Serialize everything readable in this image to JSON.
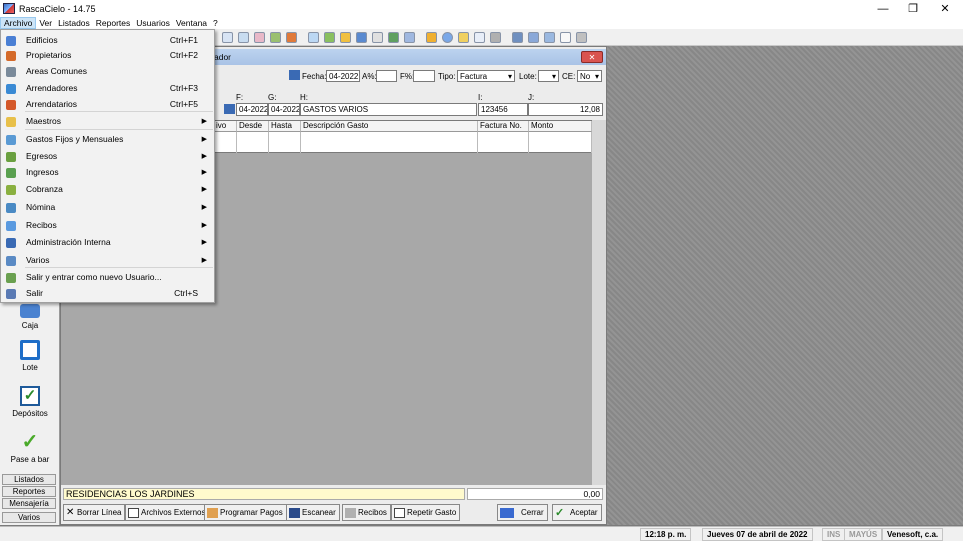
{
  "app": {
    "title": "RascaCielo - 14.75"
  },
  "menubar": [
    "Archivo",
    "Ver",
    "Listados",
    "Reportes",
    "Usuarios",
    "Ventana",
    "?"
  ],
  "archivo_menu": [
    {
      "label": "Edificios",
      "shortcut": "Ctrl+F1",
      "icon": "building-icon",
      "color": "#4a7fd4"
    },
    {
      "label": "Propietarios",
      "shortcut": "Ctrl+F2",
      "icon": "owner-icon",
      "color": "#d46a2a"
    },
    {
      "label": "Areas Comunes",
      "shortcut": "",
      "icon": "common-area-icon",
      "color": "#7a8a9a"
    },
    {
      "label": "Arrendadores",
      "shortcut": "Ctrl+F3",
      "icon": "landlord-icon",
      "color": "#3a8ad4"
    },
    {
      "label": "Arrendatarios",
      "shortcut": "Ctrl+F5",
      "icon": "tenant-icon",
      "color": "#d4582a"
    },
    {
      "label": "Maestros",
      "arrow": "▶",
      "icon": "folder-icon",
      "color": "#e8c04a"
    },
    {
      "label": "Gastos Fijos y Mensuales",
      "arrow": "▶",
      "icon": "expenses-icon",
      "color": "#5a9ad4"
    },
    {
      "label": "Egresos",
      "arrow": "▶",
      "icon": "outflow-icon",
      "color": "#6aa040"
    },
    {
      "label": "Ingresos",
      "arrow": "▶",
      "icon": "income-icon",
      "color": "#5aa050"
    },
    {
      "label": "Cobranza",
      "arrow": "▶",
      "icon": "collection-icon",
      "color": "#8ab040"
    },
    {
      "label": "Nómina",
      "arrow": "▶",
      "icon": "payroll-icon",
      "color": "#4a8ac4"
    },
    {
      "label": "Recibos",
      "arrow": "▶",
      "icon": "receipt-icon",
      "color": "#5a9ae0"
    },
    {
      "label": "Administración Interna",
      "arrow": "▶",
      "icon": "admin-icon",
      "color": "#3a6ab4"
    },
    {
      "label": "Varios",
      "arrow": "▶",
      "icon": "misc-icon",
      "color": "#5a8ac4"
    },
    {
      "label": "Salir y entrar como nuevo Usuario...",
      "shortcut": "",
      "icon": "switch-user-icon",
      "color": "#6aa050"
    },
    {
      "label": "Salir",
      "shortcut": "Ctrl+S",
      "icon": "exit-icon",
      "color": "#5a7ab4"
    }
  ],
  "child": {
    "title_frag": "ador",
    "fecha_label": "Fecha:",
    "fecha_value": "04-2022",
    "a_label": "A%:",
    "f_label": "F%:",
    "tipo_label": "Tipo:",
    "tipo_value": "Factura",
    "lote_label": "Lote:",
    "ce_label": "CE:",
    "ce_value": "No",
    "col_f": "F:",
    "col_g": "G:",
    "col_h": "H:",
    "col_i": "I:",
    "col_j": "J:",
    "row_desde": "04-2022",
    "row_hasta": "04-2022",
    "row_desc": "GASTOS VARIOS",
    "row_factura": "123456",
    "row_monto": "12,08",
    "hdr_vo": "ivo",
    "hdr_desde": "Desde",
    "hdr_hasta": "Hasta",
    "hdr_desc": "Descripción Gasto",
    "hdr_factura": "Factura No.",
    "hdr_monto": "Monto",
    "building": "RESIDENCIAS LOS JARDINES",
    "total": "0,00"
  },
  "buttons": {
    "borrar": "Borrar Línea",
    "externos": "Archivos Externos",
    "programar": "Programar Pagos",
    "escanear": "Escanear",
    "recibos": "Recibos",
    "repetir": "Repetir Gasto",
    "cerrar": "Cerrar",
    "aceptar": "Aceptar"
  },
  "sidebar": {
    "caja": "Caja",
    "lote": "Lote",
    "depositos": "Depósitos",
    "pase": "Pase a bar",
    "listados": "Listados",
    "reportes": "Reportes",
    "mensajeria": "Mensajería",
    "varios": "Varios"
  },
  "status": {
    "time": "12:18 p. m.",
    "date": "Jueves 07 de abril de 2022",
    "ins": "INS",
    "mayus": "MAYÚS",
    "company": "Venesoft, c.a."
  },
  "window_controls": {
    "minimize": "—",
    "restore": "❐",
    "close": "✕"
  }
}
